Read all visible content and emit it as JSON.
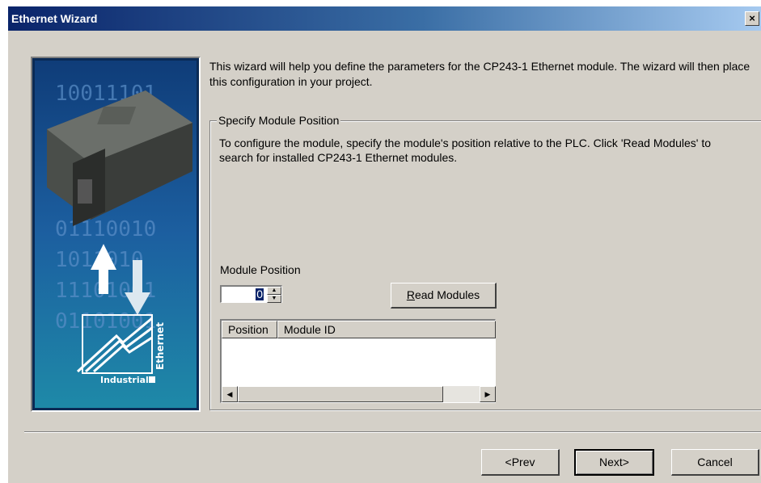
{
  "window": {
    "title": "Ethernet Wizard",
    "close_glyph": "×"
  },
  "image": {
    "binary_rows": [
      "10011101",
      "10011101",
      "01110010",
      "1011010",
      "11101001",
      "01101001"
    ],
    "logo_vertical": "Ethernet",
    "logo_text": "Industrial"
  },
  "intro": "This wizard will help you define the parameters for the CP243-1 Ethernet module. The wizard will then place this configuration in your project.",
  "group": {
    "title": "Specify Module Position",
    "description": "To configure the module, specify the module's position relative to the PLC. Click 'Read Modules' to search for installed CP243-1 Ethernet modules.",
    "position_label": "Module Position",
    "position_value": "0",
    "read_button": {
      "mnemonic": "R",
      "rest": "ead Modules"
    },
    "table": {
      "columns": [
        "Position",
        "Module ID"
      ],
      "rows": []
    }
  },
  "buttons": {
    "prev": "<Prev",
    "next": "Next>",
    "cancel": "Cancel"
  },
  "colors": {
    "face": "#d4d0c8",
    "title_start": "#0a246a",
    "title_end": "#a6caf0",
    "image_bg": "#1c5fa0"
  }
}
